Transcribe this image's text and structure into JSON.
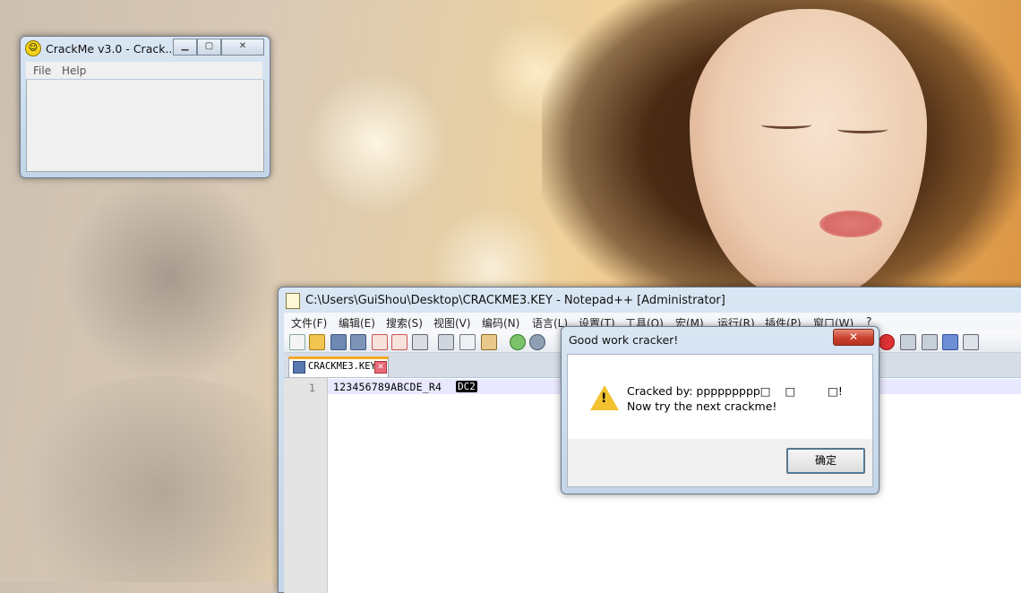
{
  "crackme": {
    "title": "CrackMe v3.0  - Crack...",
    "menu": [
      "File",
      "Help"
    ]
  },
  "notepad": {
    "title": "C:\\Users\\GuiShou\\Desktop\\CRACKME3.KEY - Notepad++ [Administrator]",
    "menu": [
      "文件(F)",
      "编辑(E)",
      "搜索(S)",
      "视图(V)",
      "编码(N)",
      "语言(L)",
      "设置(T)",
      "工具(O)",
      "宏(M)",
      "运行(R)",
      "插件(P)",
      "窗口(W)",
      "?"
    ],
    "tab_label": "CRACKME3.KEY",
    "line_number": "1",
    "line_text": "123456789ABCDE_R4",
    "line_selected": "DC2"
  },
  "messagebox": {
    "title": "Good work cracker!",
    "close_label": "✕",
    "line1": "Cracked by: ppppppppp□    □         □!",
    "line2": "Now try the next crackme!",
    "ok_label": "确定"
  },
  "colors": {
    "accent_tab": "#f5a623",
    "close_red": "#c8412d"
  }
}
